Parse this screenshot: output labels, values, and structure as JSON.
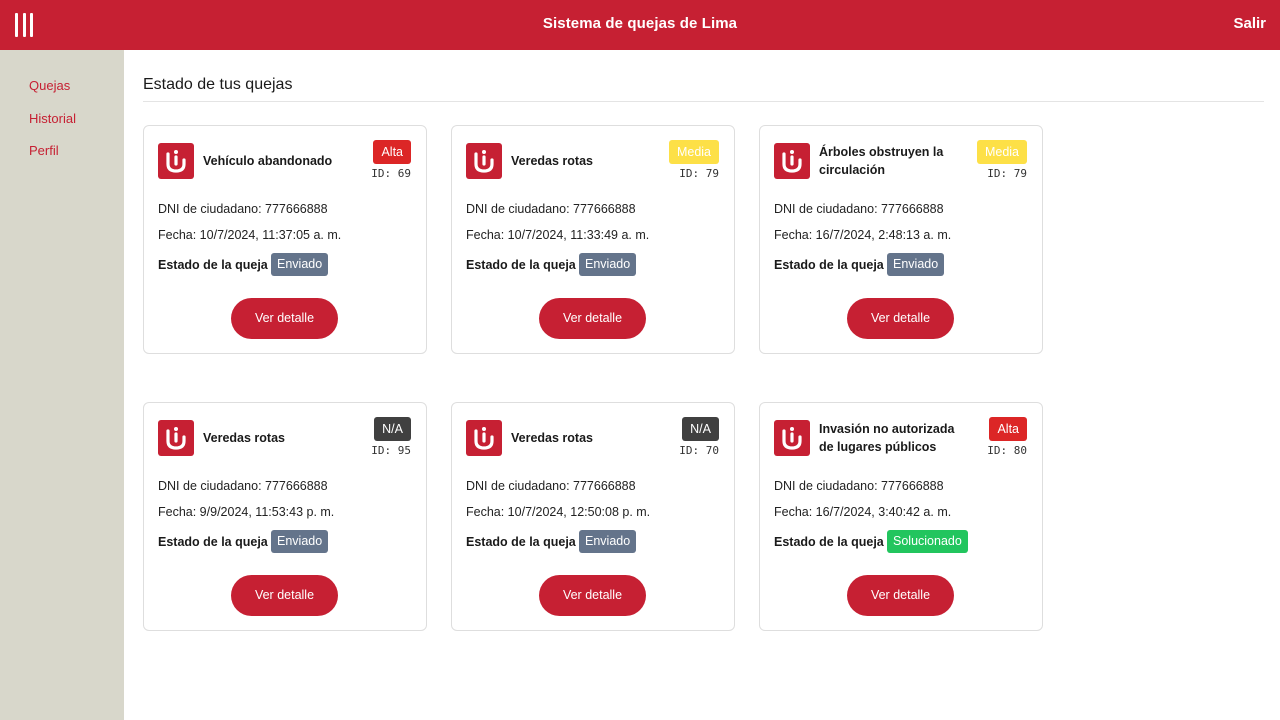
{
  "header": {
    "title": "Sistema de quejas de Lima",
    "logout_label": "Salir",
    "menu_icon": "menu-bars-icon",
    "background": "#c62033"
  },
  "sidebar": {
    "items": [
      {
        "label": "Quejas"
      },
      {
        "label": "Historial"
      },
      {
        "label": "Perfil"
      }
    ]
  },
  "main": {
    "section_title": "Estado de tus quejas"
  },
  "colors": {
    "accent": "#c62033",
    "priority_alta": "#dc2626",
    "priority_media": "#fde047",
    "priority_na": "#404040",
    "status_enviado": "#64748b",
    "status_solucionado": "#22c55e"
  },
  "cards": [
    {
      "title": "Vehículo abandonado",
      "priority": "Alta",
      "id": "ID: 69",
      "dni": "DNI de ciudadano: 777666888",
      "fecha": "Fecha: 10/7/2024, 11:37:05 a. m.",
      "estado_label": "Estado de la queja",
      "estado": "Enviado",
      "button": "Ver detalle"
    },
    {
      "title": "Veredas rotas",
      "priority": "Media",
      "id": "ID: 79",
      "dni": "DNI de ciudadano: 777666888",
      "fecha": "Fecha: 10/7/2024, 11:33:49 a. m.",
      "estado_label": "Estado de la queja",
      "estado": "Enviado",
      "button": "Ver detalle"
    },
    {
      "title": "Árboles obstruyen la circulación",
      "priority": "Media",
      "id": "ID: 79",
      "dni": "DNI de ciudadano: 777666888",
      "fecha": "Fecha: 16/7/2024, 2:48:13 a. m.",
      "estado_label": "Estado de la queja",
      "estado": "Enviado",
      "button": "Ver detalle"
    },
    {
      "title": "Veredas rotas",
      "priority": "N/A",
      "id": "ID: 95",
      "dni": "DNI de ciudadano: 777666888",
      "fecha": "Fecha: 9/9/2024, 11:53:43 p. m.",
      "estado_label": "Estado de la queja",
      "estado": "Enviado",
      "button": "Ver detalle"
    },
    {
      "title": "Veredas rotas",
      "priority": "N/A",
      "id": "ID: 70",
      "dni": "DNI de ciudadano: 777666888",
      "fecha": "Fecha: 10/7/2024, 12:50:08 p. m.",
      "estado_label": "Estado de la queja",
      "estado": "Enviado",
      "button": "Ver detalle"
    },
    {
      "title": "Invasión no autorizada de lugares públicos",
      "priority": "Alta",
      "id": "ID: 80",
      "dni": "DNI de ciudadano: 777666888",
      "fecha": "Fecha: 16/7/2024, 3:40:42 a. m.",
      "estado_label": "Estado de la queja",
      "estado": "Solucionado",
      "button": "Ver detalle"
    }
  ]
}
